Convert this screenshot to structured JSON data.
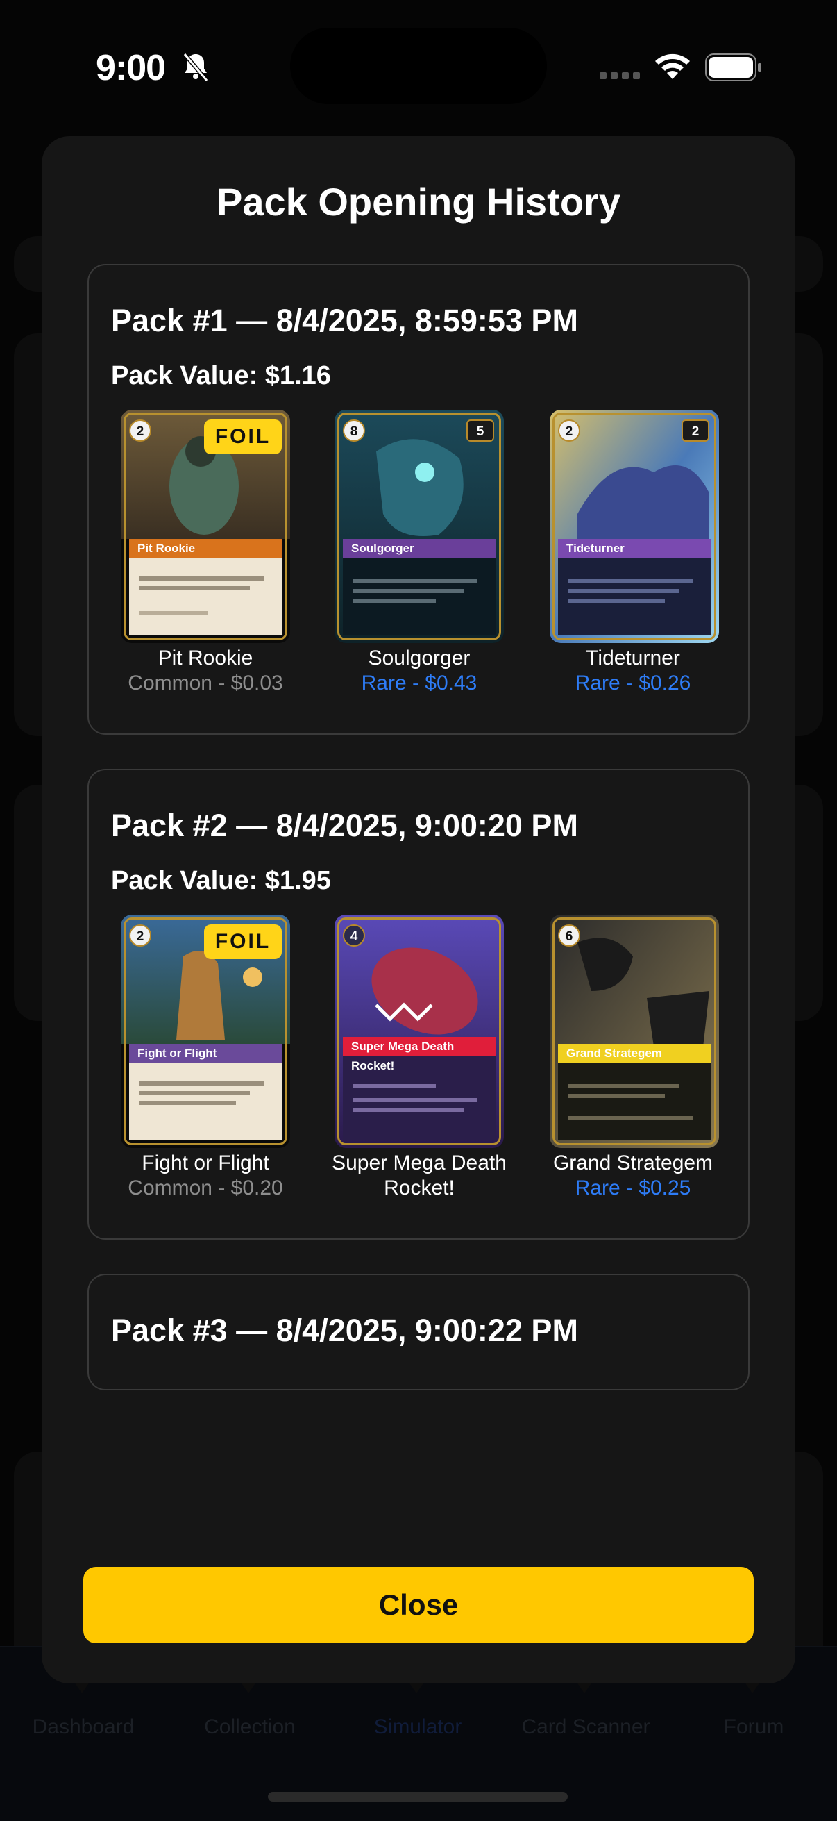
{
  "status_bar": {
    "time": "9:00"
  },
  "background": {
    "tabs": [
      "Dashboard",
      "Collection",
      "Simulator",
      "Card Scanner",
      "Forum"
    ],
    "active_tab": "Simulator"
  },
  "modal": {
    "title": "Pack Opening History",
    "packs": [
      {
        "title": "Pack #1 — 8/4/2025, 8:59:53 PM",
        "value": "Pack Value: $1.16",
        "cards": [
          {
            "name": "Pit Rookie",
            "meta": "Common - $0.03",
            "rarity": "common",
            "foil": "FOIL",
            "cost": "2",
            "band_label": "Pit Rookie"
          },
          {
            "name": "Soulgorger",
            "meta": "Rare - $0.43",
            "rarity": "rare",
            "cost": "8",
            "might": "5",
            "band_label": "Soulgorger"
          },
          {
            "name": "Tideturner",
            "meta": "Rare - $0.26",
            "rarity": "rare",
            "cost": "2",
            "might": "2",
            "band_label": "Tideturner"
          }
        ]
      },
      {
        "title": "Pack #2 — 8/4/2025, 9:00:20 PM",
        "value": "Pack Value: $1.95",
        "cards": [
          {
            "name": "Fight or Flight",
            "meta": "Common - $0.20",
            "rarity": "common",
            "foil": "FOIL",
            "cost": "2",
            "band_label": "Fight or Flight"
          },
          {
            "name": "Super Mega Death Rocket!",
            "meta": "",
            "rarity": "",
            "cost": "4",
            "band_label": "Super Mega Death Rocket!"
          },
          {
            "name": "Grand Strategem",
            "meta": "Rare - $0.25",
            "rarity": "rare",
            "cost": "6",
            "band_label": "Grand Strategem"
          }
        ]
      },
      {
        "title": "Pack #3 — 8/4/2025, 9:00:22 PM"
      }
    ],
    "close_label": "Close"
  },
  "colors": {
    "accent": "#ffc800",
    "rare": "#2e7cf6",
    "common": "#8e8e8e",
    "foil": "#ffd418",
    "modal_bg": "#161616"
  }
}
